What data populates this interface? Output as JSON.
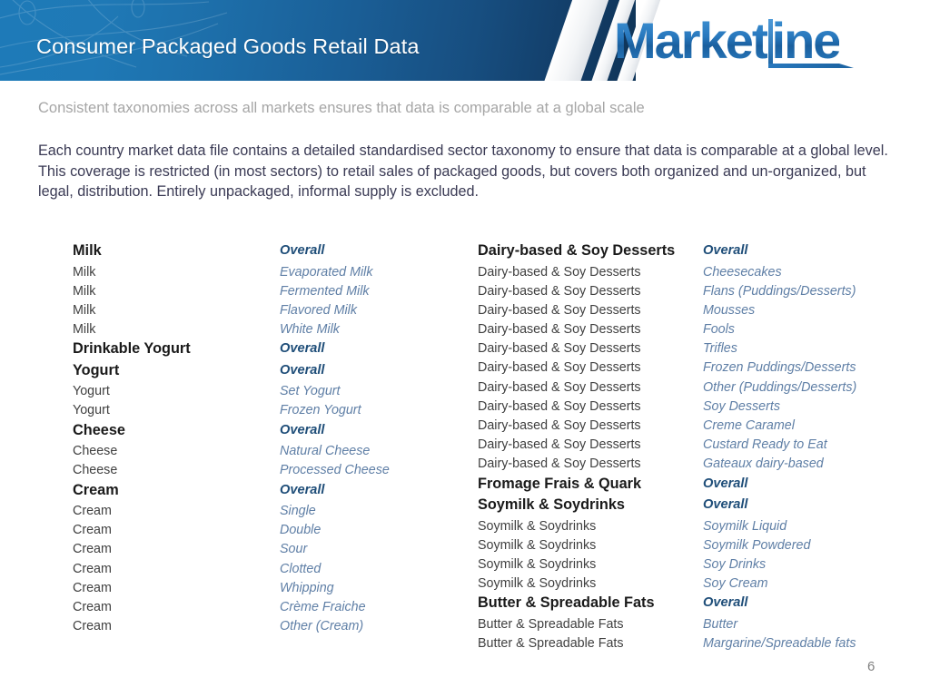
{
  "header": {
    "title": "Consumer Packaged Goods Retail Data",
    "logo": {
      "part1": "Market",
      "part2": "ine",
      "l_letter": "L"
    },
    "colors": {
      "band_light_blue": "#1e7ab8",
      "band_dark_navy": "#0f3457",
      "logo_blue": "#2878bd",
      "subcategory_blue": "#5f7fa6",
      "subcategory_bold_blue": "#1f4e79"
    }
  },
  "subtitle": "Consistent taxonomies across all markets ensures that data is comparable at a global scale",
  "body": "Each country market data file contains a detailed standardised sector taxonomy to ensure that data is comparable at a global level.  This coverage is restricted (in most sectors) to retail sales of packaged goods, but covers both organized and un-organized, but legal, distribution. Entirely unpackaged, informal supply is excluded.",
  "taxonomy": {
    "left": [
      {
        "category": "Milk",
        "category_bold": true,
        "sub": "Overall",
        "sub_bold": true
      },
      {
        "category": "Milk",
        "category_bold": false,
        "sub": "Evaporated Milk",
        "sub_bold": false
      },
      {
        "category": "Milk",
        "category_bold": false,
        "sub": "Fermented Milk",
        "sub_bold": false
      },
      {
        "category": "Milk",
        "category_bold": false,
        "sub": "Flavored Milk",
        "sub_bold": false
      },
      {
        "category": "Milk",
        "category_bold": false,
        "sub": "White Milk",
        "sub_bold": false
      },
      {
        "category": "Drinkable Yogurt",
        "category_bold": true,
        "sub": "Overall",
        "sub_bold": true
      },
      {
        "category": "Yogurt",
        "category_bold": true,
        "sub": "Overall",
        "sub_bold": true
      },
      {
        "category": "Yogurt",
        "category_bold": false,
        "sub": "Set Yogurt",
        "sub_bold": false
      },
      {
        "category": "Yogurt",
        "category_bold": false,
        "sub": "Frozen Yogurt",
        "sub_bold": false
      },
      {
        "category": "Cheese",
        "category_bold": true,
        "sub": "Overall",
        "sub_bold": true
      },
      {
        "category": "Cheese",
        "category_bold": false,
        "sub": "Natural Cheese",
        "sub_bold": false
      },
      {
        "category": "Cheese",
        "category_bold": false,
        "sub": "Processed Cheese",
        "sub_bold": false
      },
      {
        "category": "Cream",
        "category_bold": true,
        "sub": "Overall",
        "sub_bold": true
      },
      {
        "category": "Cream",
        "category_bold": false,
        "sub": "Single",
        "sub_bold": false
      },
      {
        "category": "Cream",
        "category_bold": false,
        "sub": "Double",
        "sub_bold": false
      },
      {
        "category": "Cream",
        "category_bold": false,
        "sub": "Sour",
        "sub_bold": false
      },
      {
        "category": "Cream",
        "category_bold": false,
        "sub": "Clotted",
        "sub_bold": false
      },
      {
        "category": "Cream",
        "category_bold": false,
        "sub": "Whipping",
        "sub_bold": false
      },
      {
        "category": "Cream",
        "category_bold": false,
        "sub": "Crème Fraiche",
        "sub_bold": false
      },
      {
        "category": "Cream",
        "category_bold": false,
        "sub": "Other (Cream)",
        "sub_bold": false
      }
    ],
    "right": [
      {
        "category": "Dairy-based & Soy Desserts",
        "category_bold": true,
        "sub": "Overall",
        "sub_bold": true
      },
      {
        "category": "Dairy-based & Soy Desserts",
        "category_bold": false,
        "sub": "Cheesecakes",
        "sub_bold": false
      },
      {
        "category": "Dairy-based & Soy Desserts",
        "category_bold": false,
        "sub": "Flans (Puddings/Desserts)",
        "sub_bold": false
      },
      {
        "category": "Dairy-based & Soy Desserts",
        "category_bold": false,
        "sub": "Mousses",
        "sub_bold": false
      },
      {
        "category": "Dairy-based & Soy Desserts",
        "category_bold": false,
        "sub": "Fools",
        "sub_bold": false
      },
      {
        "category": "Dairy-based & Soy Desserts",
        "category_bold": false,
        "sub": "Trifles",
        "sub_bold": false
      },
      {
        "category": "Dairy-based & Soy Desserts",
        "category_bold": false,
        "sub": "Frozen Puddings/Desserts",
        "sub_bold": false
      },
      {
        "category": "Dairy-based & Soy Desserts",
        "category_bold": false,
        "sub": "Other (Puddings/Desserts)",
        "sub_bold": false
      },
      {
        "category": "Dairy-based & Soy Desserts",
        "category_bold": false,
        "sub": "Soy Desserts",
        "sub_bold": false
      },
      {
        "category": "Dairy-based & Soy Desserts",
        "category_bold": false,
        "sub": "Creme Caramel",
        "sub_bold": false
      },
      {
        "category": "Dairy-based & Soy Desserts",
        "category_bold": false,
        "sub": "Custard Ready to Eat",
        "sub_bold": false
      },
      {
        "category": "Dairy-based & Soy Desserts",
        "category_bold": false,
        "sub": "Gateaux dairy-based",
        "sub_bold": false
      },
      {
        "category": "Fromage Frais & Quark",
        "category_bold": true,
        "sub": "Overall",
        "sub_bold": true
      },
      {
        "category": "Soymilk & Soydrinks",
        "category_bold": true,
        "sub": "Overall",
        "sub_bold": true
      },
      {
        "category": "Soymilk & Soydrinks",
        "category_bold": false,
        "sub": "Soymilk Liquid",
        "sub_bold": false
      },
      {
        "category": "Soymilk & Soydrinks",
        "category_bold": false,
        "sub": "Soymilk Powdered",
        "sub_bold": false
      },
      {
        "category": "Soymilk & Soydrinks",
        "category_bold": false,
        "sub": "Soy Drinks",
        "sub_bold": false
      },
      {
        "category": "Soymilk & Soydrinks",
        "category_bold": false,
        "sub": "Soy Cream",
        "sub_bold": false
      },
      {
        "category": "Butter & Spreadable Fats",
        "category_bold": true,
        "sub": "Overall",
        "sub_bold": true
      },
      {
        "category": "Butter & Spreadable Fats",
        "category_bold": false,
        "sub": "Butter",
        "sub_bold": false
      },
      {
        "category": "Butter & Spreadable Fats",
        "category_bold": false,
        "sub": "Margarine/Spreadable fats",
        "sub_bold": false
      }
    ]
  },
  "page_number": "6"
}
